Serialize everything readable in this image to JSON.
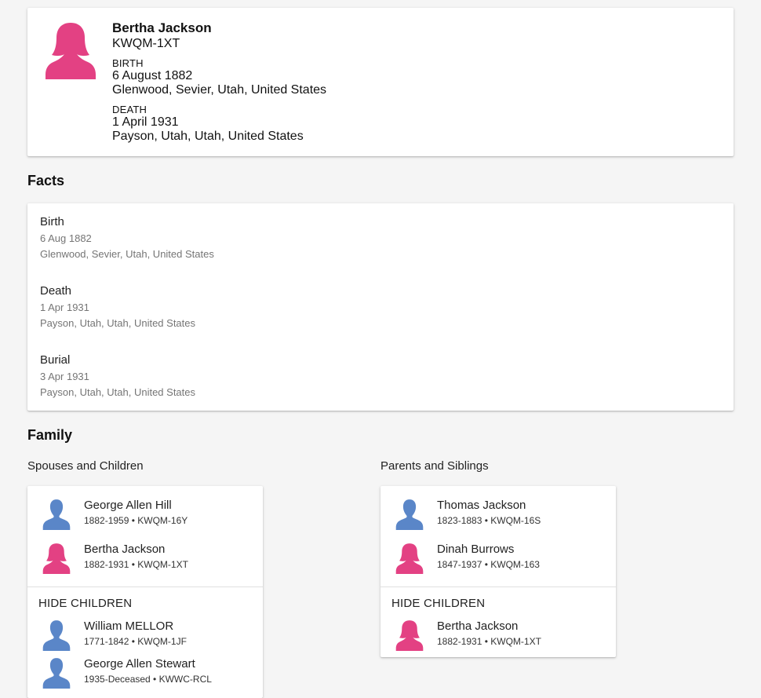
{
  "colors": {
    "female": "#e34183",
    "male": "#5a86c8"
  },
  "person": {
    "name": "Bertha Jackson",
    "id": "KWQM-1XT",
    "gender_icon": "female-person-icon",
    "birth": {
      "label": "BIRTH",
      "date": "6 August 1882",
      "place": "Glenwood, Sevier, Utah, United States"
    },
    "death": {
      "label": "DEATH",
      "date": "1 April 1931",
      "place": "Payson, Utah, Utah, United States"
    }
  },
  "facts": {
    "heading": "Facts",
    "items": [
      {
        "title": "Birth",
        "date": "6 Aug 1882",
        "place": "Glenwood, Sevier, Utah, United States"
      },
      {
        "title": "Death",
        "date": "1 Apr 1931",
        "place": "Payson, Utah, Utah, United States"
      },
      {
        "title": "Burial",
        "date": "3 Apr 1931",
        "place": "Payson, Utah, Utah, United States"
      }
    ]
  },
  "family": {
    "heading": "Family",
    "spouses": {
      "heading": "Spouses and Children",
      "couple": [
        {
          "name": "George Allen Hill",
          "meta": "1882-1959 • KWQM-16Y",
          "gender": "male"
        },
        {
          "name": "Bertha Jackson",
          "meta": "1882-1931 • KWQM-1XT",
          "gender": "female"
        }
      ],
      "toggle_label": "HIDE CHILDREN",
      "children": [
        {
          "name": "William MELLOR",
          "meta": "1771-1842 • KWQM-1JF",
          "gender": "male"
        },
        {
          "name": "George Allen Stewart",
          "meta": "1935-Deceased • KWWC-RCL",
          "gender": "male"
        }
      ]
    },
    "parents": {
      "heading": "Parents and Siblings",
      "couple": [
        {
          "name": "Thomas Jackson",
          "meta": "1823-1883 • KWQM-16S",
          "gender": "male"
        },
        {
          "name": "Dinah Burrows",
          "meta": "1847-1937 • KWQM-163",
          "gender": "female"
        }
      ],
      "toggle_label": "HIDE CHILDREN",
      "children": [
        {
          "name": "Bertha Jackson",
          "meta": "1882-1931 • KWQM-1XT",
          "gender": "female"
        }
      ]
    }
  }
}
